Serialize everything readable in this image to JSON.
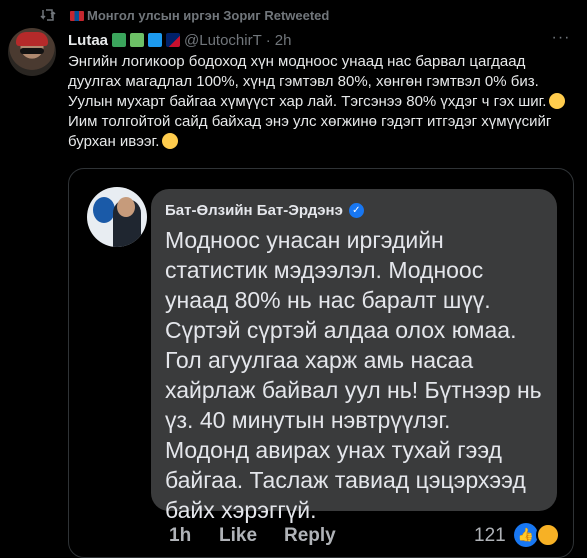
{
  "retweet": {
    "icon": "retweet-icon",
    "label": "Монгол улсын иргэн Зориг",
    "suffix": " Retweeted"
  },
  "author": {
    "name": "Lutaa",
    "handle": "@LutochirT",
    "separator": "·",
    "time": "2h",
    "more": "···"
  },
  "tweet": {
    "lines": [
      "Энгийн логикоор бодоход хүн модноос унаад нас барвал цагдаад",
      "дуулгах магадлал 100%, хүнд гэмтэвл 80%, хөнгөн гэмтвэл 0% биз.",
      "Уулын мухарт байгаа хүмүүст хар лай. Тэгсэнээ 80% үхдэг ч гэх шиг.",
      "Иим толгойтой сайд байхад энэ улс хөгжинө гэдэгт итгэдэг хүмүүсийг",
      "бурхан ивээг."
    ]
  },
  "quote": {
    "name": "Бат-Өлзийн Бат-Эрдэнэ",
    "verified": "✓",
    "lines": [
      "Модноос унасан иргэдийн",
      "статистик мэдээлэл. Модноос",
      "унаад 80% нь нас баралт шүү.",
      "Сүртэй сүртэй алдаа олох юмаа.",
      "Гол агуулгаа харж амь насаа",
      "хайрлаж байвал уул нь! Бүтнээр нь",
      "үз. 40 минутын нэвтрүүлэг.",
      "Модонд авирах унах тухай гээд",
      "байгаа. Таслаж тавиад цэцэрхээд",
      "байх хэрэггүй."
    ],
    "time": "1h",
    "like": "Like",
    "reply": "Reply",
    "reaction_count": "121",
    "reaction_like_glyph": "👍"
  }
}
